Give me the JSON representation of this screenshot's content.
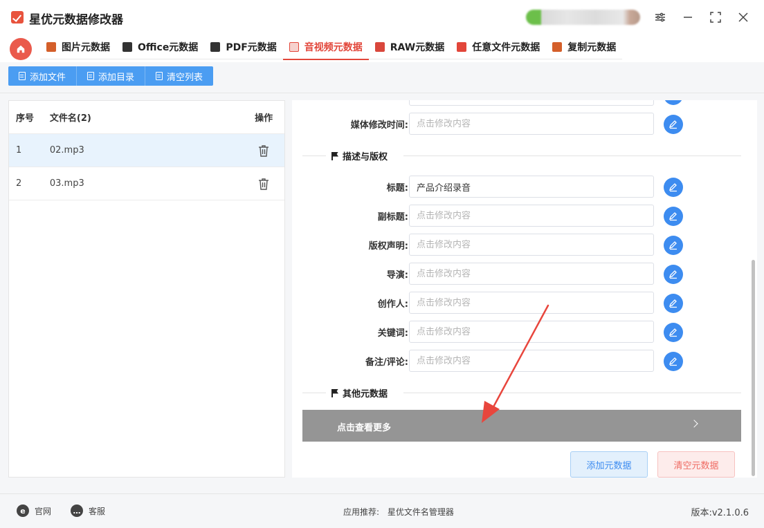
{
  "app": {
    "title": "星优元数据修改器"
  },
  "tabs": [
    {
      "label": "图片元数据",
      "icon": "image-icon",
      "color": "#d45f2a"
    },
    {
      "label": "Office元数据",
      "icon": "office-icon",
      "color": "#333333"
    },
    {
      "label": "PDF元数据",
      "icon": "pdf-icon",
      "color": "#333333"
    },
    {
      "label": "音视频元数据",
      "icon": "media-icon",
      "color": "#e2463a"
    },
    {
      "label": "RAW元数据",
      "icon": "raw-icon",
      "color": "#d9473c"
    },
    {
      "label": "任意文件元数据",
      "icon": "file-icon",
      "color": "#e2463a"
    },
    {
      "label": "复制元数据",
      "icon": "copy-icon",
      "color": "#d45f2a"
    }
  ],
  "toolbar": {
    "add_file": "添加文件",
    "add_dir": "添加目录",
    "clear_list": "清空列表"
  },
  "file_table": {
    "headers": {
      "index": "序号",
      "name": "文件名(2)",
      "action": "操作"
    },
    "rows": [
      {
        "index": "1",
        "name": "02.mp3"
      },
      {
        "index": "2",
        "name": "03.mp3"
      }
    ]
  },
  "metadata": {
    "media_modified_label": "媒体修改时间:",
    "section_desc": "描述与版权",
    "section_other": "其他元数据",
    "placeholder": "点击修改内容",
    "fields": [
      {
        "label": "标题:",
        "value": "产品介绍录音"
      },
      {
        "label": "副标题:",
        "value": ""
      },
      {
        "label": "版权声明:",
        "value": ""
      },
      {
        "label": "导演:",
        "value": ""
      },
      {
        "label": "创作人:",
        "value": ""
      },
      {
        "label": "关键词:",
        "value": ""
      },
      {
        "label": "备注/评论:",
        "value": ""
      }
    ],
    "view_more": "点击查看更多",
    "add_button": "添加元数据",
    "clear_button": "清空元数据"
  },
  "statusbar": {
    "website": "官网",
    "support": "客服",
    "recommend_label": "应用推荐:",
    "recommend_app": "星优文件名管理器",
    "version": "版本:v2.1.0.6"
  },
  "colors": {
    "accent": "#e2463a",
    "primary": "#4b9df2",
    "edit": "#3d8cf0",
    "arrow": "#e8463d"
  }
}
